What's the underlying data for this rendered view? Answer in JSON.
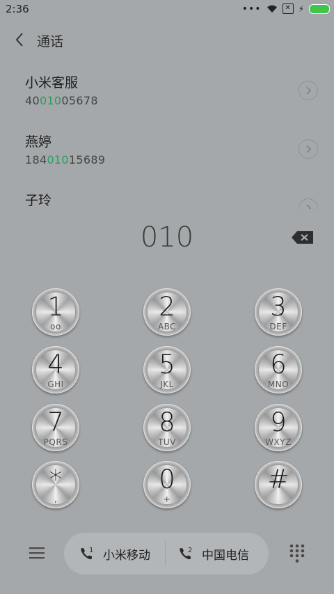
{
  "status": {
    "time": "2:36"
  },
  "header": {
    "title": "通话"
  },
  "contacts": [
    {
      "name": "小米客服",
      "number_pre": "40",
      "number_match": "010",
      "number_post": "05678"
    },
    {
      "name": "燕婷",
      "number_pre": "184",
      "number_match": "010",
      "number_post": "15689"
    },
    {
      "name": "子玲"
    }
  ],
  "dialer": {
    "input": "010"
  },
  "keys": [
    {
      "digit": "1",
      "sub": "oo"
    },
    {
      "digit": "2",
      "sub": "ABC"
    },
    {
      "digit": "3",
      "sub": "DEF"
    },
    {
      "digit": "4",
      "sub": "GHI"
    },
    {
      "digit": "5",
      "sub": "JKL"
    },
    {
      "digit": "6",
      "sub": "MNO"
    },
    {
      "digit": "7",
      "sub": "PQRS"
    },
    {
      "digit": "8",
      "sub": "TUV"
    },
    {
      "digit": "9",
      "sub": "WXYZ"
    },
    {
      "digit": "*",
      "sub": ","
    },
    {
      "digit": "0",
      "sub": "+"
    },
    {
      "digit": "#",
      "sub": ""
    }
  ],
  "sims": [
    {
      "index": "1",
      "label": "小米移动"
    },
    {
      "index": "2",
      "label": "中国电信"
    }
  ],
  "colors": {
    "background": "#a4a8aa",
    "match_highlight": "#2a9d5a",
    "battery": "#3ec54a"
  }
}
